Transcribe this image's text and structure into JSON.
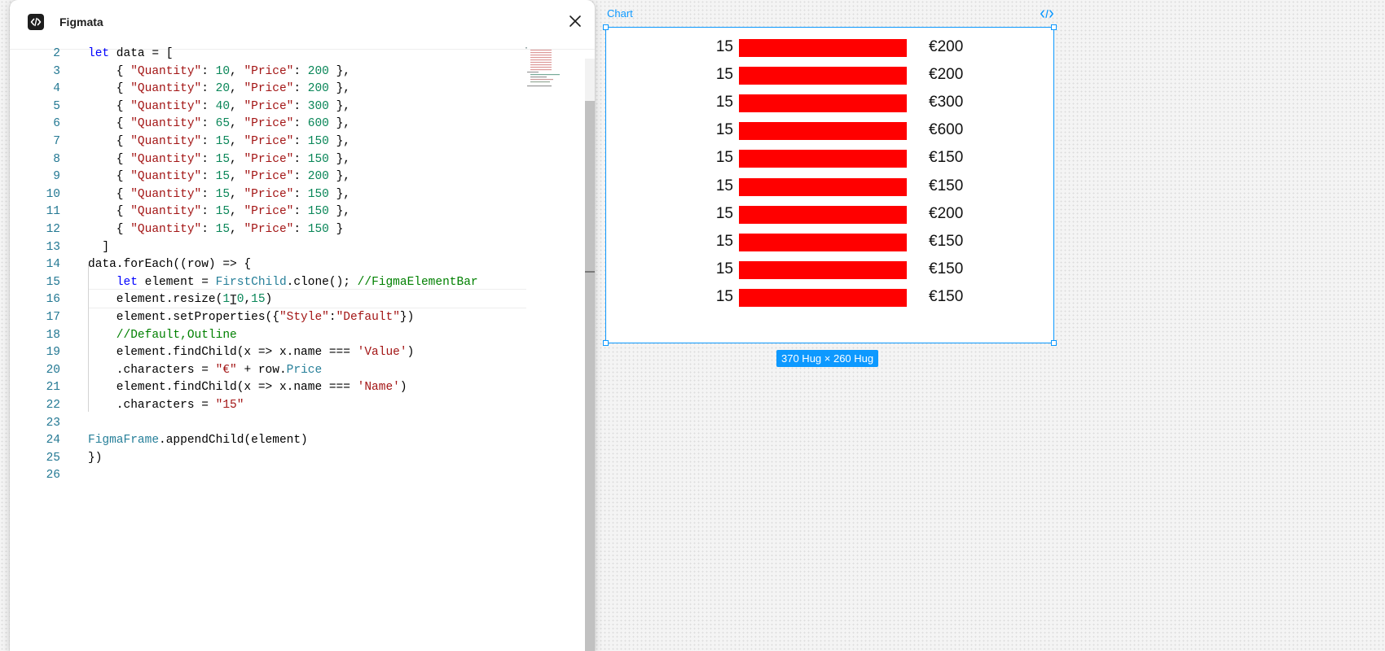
{
  "plugin": {
    "title": "Figmata",
    "icons": {
      "logo": "code-brackets-icon",
      "close": "close-icon"
    }
  },
  "editor": {
    "cursor_line": 16,
    "lines": [
      {
        "n": "2",
        "tokens": [
          [
            "kw",
            "let"
          ],
          [
            "p",
            " data = ["
          ]
        ]
      },
      {
        "n": "3",
        "tokens": [
          [
            "p",
            "    { "
          ],
          [
            "str",
            "\"Quantity\""
          ],
          [
            "p",
            ": "
          ],
          [
            "num",
            "10"
          ],
          [
            "p",
            ", "
          ],
          [
            "str",
            "\"Price\""
          ],
          [
            "p",
            ": "
          ],
          [
            "num",
            "200"
          ],
          [
            "p",
            " },"
          ]
        ]
      },
      {
        "n": "4",
        "tokens": [
          [
            "p",
            "    { "
          ],
          [
            "str",
            "\"Quantity\""
          ],
          [
            "p",
            ": "
          ],
          [
            "num",
            "20"
          ],
          [
            "p",
            ", "
          ],
          [
            "str",
            "\"Price\""
          ],
          [
            "p",
            ": "
          ],
          [
            "num",
            "200"
          ],
          [
            "p",
            " },"
          ]
        ]
      },
      {
        "n": "5",
        "tokens": [
          [
            "p",
            "    { "
          ],
          [
            "str",
            "\"Quantity\""
          ],
          [
            "p",
            ": "
          ],
          [
            "num",
            "40"
          ],
          [
            "p",
            ", "
          ],
          [
            "str",
            "\"Price\""
          ],
          [
            "p",
            ": "
          ],
          [
            "num",
            "300"
          ],
          [
            "p",
            " },"
          ]
        ]
      },
      {
        "n": "6",
        "tokens": [
          [
            "p",
            "    { "
          ],
          [
            "str",
            "\"Quantity\""
          ],
          [
            "p",
            ": "
          ],
          [
            "num",
            "65"
          ],
          [
            "p",
            ", "
          ],
          [
            "str",
            "\"Price\""
          ],
          [
            "p",
            ": "
          ],
          [
            "num",
            "600"
          ],
          [
            "p",
            " },"
          ]
        ]
      },
      {
        "n": "7",
        "tokens": [
          [
            "p",
            "    { "
          ],
          [
            "str",
            "\"Quantity\""
          ],
          [
            "p",
            ": "
          ],
          [
            "num",
            "15"
          ],
          [
            "p",
            ", "
          ],
          [
            "str",
            "\"Price\""
          ],
          [
            "p",
            ": "
          ],
          [
            "num",
            "150"
          ],
          [
            "p",
            " },"
          ]
        ]
      },
      {
        "n": "8",
        "tokens": [
          [
            "p",
            "    { "
          ],
          [
            "str",
            "\"Quantity\""
          ],
          [
            "p",
            ": "
          ],
          [
            "num",
            "15"
          ],
          [
            "p",
            ", "
          ],
          [
            "str",
            "\"Price\""
          ],
          [
            "p",
            ": "
          ],
          [
            "num",
            "150"
          ],
          [
            "p",
            " },"
          ]
        ]
      },
      {
        "n": "9",
        "tokens": [
          [
            "p",
            "    { "
          ],
          [
            "str",
            "\"Quantity\""
          ],
          [
            "p",
            ": "
          ],
          [
            "num",
            "15"
          ],
          [
            "p",
            ", "
          ],
          [
            "str",
            "\"Price\""
          ],
          [
            "p",
            ": "
          ],
          [
            "num",
            "200"
          ],
          [
            "p",
            " },"
          ]
        ]
      },
      {
        "n": "10",
        "tokens": [
          [
            "p",
            "    { "
          ],
          [
            "str",
            "\"Quantity\""
          ],
          [
            "p",
            ": "
          ],
          [
            "num",
            "15"
          ],
          [
            "p",
            ", "
          ],
          [
            "str",
            "\"Price\""
          ],
          [
            "p",
            ": "
          ],
          [
            "num",
            "150"
          ],
          [
            "p",
            " },"
          ]
        ]
      },
      {
        "n": "11",
        "tokens": [
          [
            "p",
            "    { "
          ],
          [
            "str",
            "\"Quantity\""
          ],
          [
            "p",
            ": "
          ],
          [
            "num",
            "15"
          ],
          [
            "p",
            ", "
          ],
          [
            "str",
            "\"Price\""
          ],
          [
            "p",
            ": "
          ],
          [
            "num",
            "150"
          ],
          [
            "p",
            " },"
          ]
        ]
      },
      {
        "n": "12",
        "tokens": [
          [
            "p",
            "    { "
          ],
          [
            "str",
            "\"Quantity\""
          ],
          [
            "p",
            ": "
          ],
          [
            "num",
            "15"
          ],
          [
            "p",
            ", "
          ],
          [
            "str",
            "\"Price\""
          ],
          [
            "p",
            ": "
          ],
          [
            "num",
            "150"
          ],
          [
            "p",
            " }"
          ]
        ]
      },
      {
        "n": "13",
        "tokens": [
          [
            "p",
            "  ]"
          ]
        ]
      },
      {
        "n": "14",
        "tokens": [
          [
            "p",
            "data.forEach((row) => {"
          ]
        ]
      },
      {
        "n": "15",
        "tokens": [
          [
            "p",
            "    "
          ],
          [
            "kw",
            "let"
          ],
          [
            "p",
            " element = "
          ],
          [
            "ty",
            "FirstChild"
          ],
          [
            "p",
            ".clone(); "
          ],
          [
            "cm",
            "//FigmaElementBar"
          ]
        ]
      },
      {
        "n": "16",
        "tokens": [
          [
            "p",
            "    element.resize("
          ],
          [
            "num",
            "1"
          ],
          [
            "p",
            " "
          ],
          [
            "num",
            "0"
          ],
          [
            "p",
            ","
          ],
          [
            "num",
            "15"
          ],
          [
            "p",
            ")"
          ]
        ]
      },
      {
        "n": "17",
        "tokens": [
          [
            "p",
            "    element.setProperties({"
          ],
          [
            "str",
            "\"Style\""
          ],
          [
            "p",
            ":"
          ],
          [
            "str",
            "\"Default\""
          ],
          [
            "p",
            "})"
          ]
        ]
      },
      {
        "n": "18",
        "tokens": [
          [
            "cm",
            "    //Default,Outline"
          ]
        ]
      },
      {
        "n": "19",
        "tokens": [
          [
            "p",
            "    element.findChild(x => x.name === "
          ],
          [
            "str",
            "'Value'"
          ],
          [
            "p",
            ")"
          ]
        ]
      },
      {
        "n": "20",
        "tokens": [
          [
            "p",
            "    .characters = "
          ],
          [
            "str",
            "\"€\""
          ],
          [
            "p",
            " + row."
          ],
          [
            "ty",
            "Price"
          ]
        ]
      },
      {
        "n": "21",
        "tokens": [
          [
            "p",
            "    element.findChild(x => x.name === "
          ],
          [
            "str",
            "'Name'"
          ],
          [
            "p",
            ")"
          ]
        ]
      },
      {
        "n": "22",
        "tokens": [
          [
            "p",
            "    .characters = "
          ],
          [
            "str",
            "\"15\""
          ]
        ]
      },
      {
        "n": "23",
        "tokens": []
      },
      {
        "n": "24",
        "tokens": [
          [
            "ty",
            "FigmaFrame"
          ],
          [
            "p",
            ".appendChild(element)"
          ]
        ]
      },
      {
        "n": "25",
        "tokens": [
          [
            "p",
            "})"
          ]
        ]
      },
      {
        "n": "26",
        "tokens": []
      }
    ]
  },
  "canvas": {
    "frame_label": "Chart",
    "frame_icon": "code-brackets-icon",
    "size_badge": "370 Hug × 260 Hug",
    "colors": {
      "selection": "#0d99ff",
      "bar": "#ff0000"
    }
  },
  "chart_data": {
    "type": "bar",
    "orientation": "horizontal",
    "categories": [
      "15",
      "15",
      "15",
      "15",
      "15",
      "15",
      "15",
      "15",
      "15",
      "15"
    ],
    "bar_fill_fraction": [
      1,
      1,
      1,
      1,
      1,
      1,
      1,
      1,
      1,
      1
    ],
    "value_labels": [
      "€200",
      "€200",
      "€300",
      "€600",
      "€150",
      "€150",
      "€200",
      "€150",
      "€150",
      "€150"
    ],
    "values": [
      200,
      200,
      300,
      600,
      150,
      150,
      200,
      150,
      150,
      150
    ]
  }
}
